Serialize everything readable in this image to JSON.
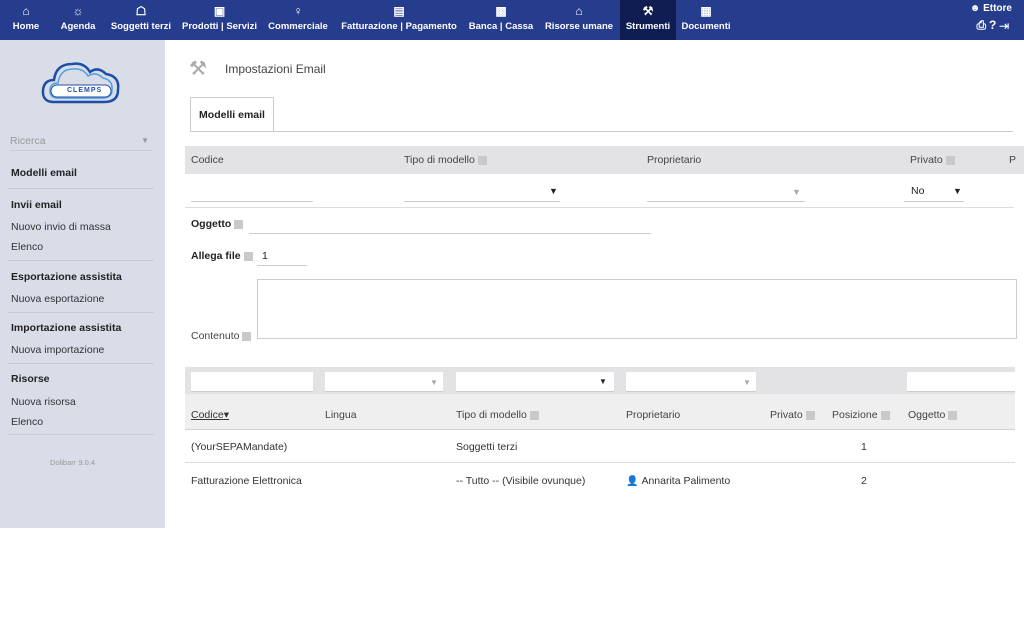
{
  "topbar": {
    "menu": [
      {
        "label": "Home",
        "icon": "home-icon",
        "glyph": "⌂"
      },
      {
        "label": "Agenda",
        "icon": "agenda-icon",
        "glyph": "☼"
      },
      {
        "label": "Soggetti terzi",
        "icon": "building-icon",
        "glyph": "☖"
      },
      {
        "label": "Prodotti | Servizi",
        "icon": "cubes-icon",
        "glyph": "▣"
      },
      {
        "label": "Commerciale",
        "icon": "suitcase-icon",
        "glyph": "♀"
      },
      {
        "label": "Fatturazione | Pagamento",
        "icon": "money-icon",
        "glyph": "▤"
      },
      {
        "label": "Banca | Cassa",
        "icon": "bank-icon",
        "glyph": "▩"
      },
      {
        "label": "Risorse umane",
        "icon": "people-icon",
        "glyph": "⌂"
      },
      {
        "label": "Strumenti",
        "icon": "tools-icon",
        "glyph": "⚒"
      },
      {
        "label": "Documenti",
        "icon": "documents-icon",
        "glyph": "▦"
      }
    ],
    "user_name": "Ettore",
    "user_icons": [
      "print-icon",
      "help-icon",
      "logout-icon"
    ]
  },
  "sidebar": {
    "logo_text": "CLEMPS",
    "search_placeholder": "Ricerca",
    "sections": [
      {
        "title": "Modelli email",
        "links": []
      },
      {
        "title": "Invii email",
        "links": [
          "Nuovo invio di massa",
          "Elenco"
        ]
      },
      {
        "title": "Esportazione assistita",
        "links": [
          "Nuova esportazione"
        ]
      },
      {
        "title": "Importazione assistita",
        "links": [
          "Nuova importazione"
        ]
      },
      {
        "title": "Risorse",
        "links": [
          "Nuova risorsa",
          "Elenco"
        ]
      }
    ],
    "version": "Dolibarr 9.0.4"
  },
  "page": {
    "title": "Impostazioni Email",
    "tab": "Modelli email"
  },
  "form": {
    "headers": {
      "codice": "Codice",
      "tipo": "Tipo di modello",
      "proprietario": "Proprietario",
      "privato": "Privato",
      "extra": "P"
    },
    "privato_value": "No",
    "oggetto_label": "Oggetto",
    "allega_label": "Allega file",
    "allega_value": "1",
    "contenuto_label": "Contenuto"
  },
  "list": {
    "headers": [
      "Codice",
      "Lingua",
      "Tipo di modello",
      "Proprietario",
      "Privato",
      "Posizione",
      "Oggetto"
    ],
    "rows": [
      {
        "codice": "(YourSEPAMandate)",
        "lingua": "",
        "tipo": "Soggetti terzi",
        "proprietario": "",
        "privato": "",
        "posizione": "1",
        "oggetto": ""
      },
      {
        "codice": "Fatturazione Elettronica",
        "lingua": "",
        "tipo": "-- Tutto -- (Visibile ovunque)",
        "proprietario": "Annarita Palimento",
        "privato": "",
        "posizione": "2",
        "oggetto": ""
      }
    ]
  }
}
